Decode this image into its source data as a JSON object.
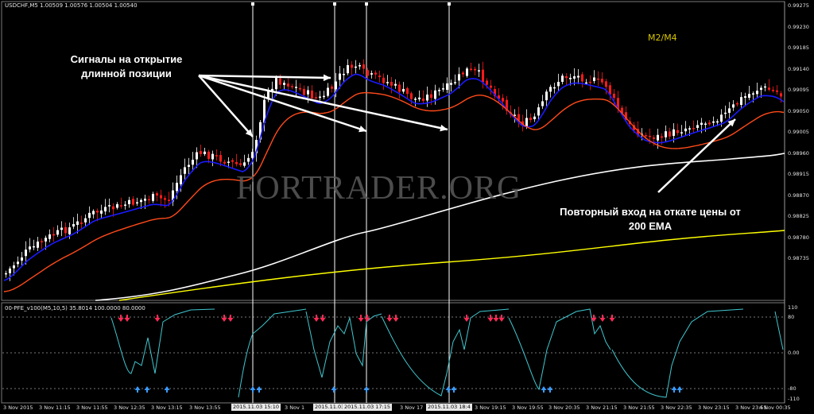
{
  "window": {
    "title": "USDCHF,M5  1.00509 1.00576 1.00504 1.00540",
    "timeframe_label": "M2/M4"
  },
  "indicator": {
    "label": "00-PFE_v100(M5,10,5) 35.8014 100.0000 80.0000",
    "y_ticks": [
      "110",
      "80",
      "0.00",
      "-80",
      "-110"
    ]
  },
  "annotations": {
    "entry_signals": "Сигналы на открытие длинной позиции",
    "reentry": "Повторный вход на откате цены от 200 EMA"
  },
  "watermark": "FORTRADER.ORG",
  "price_axis": {
    "ticks": [
      "0.99275",
      "0.99230",
      "0.99185",
      "0.99140",
      "0.99095",
      "0.99050",
      "0.99005",
      "0.98960",
      "0.98915",
      "0.98870",
      "0.98825",
      "0.98780",
      "0.98735"
    ]
  },
  "time_axis": {
    "ticks": [
      "3 Nov 2015",
      "3 Nov 11:15",
      "3 Nov 11:55",
      "3 Nov 12:35",
      "3 Nov 13:15",
      "3 Nov 13:55",
      "3 Nov 1",
      "3 Nov 17",
      "3 Nov 19:15",
      "3 Nov 19:55",
      "3 Nov 20:35",
      "3 Nov 21:15",
      "3 Nov 21:55",
      "3 Nov 22:35",
      "3 Nov 23:15",
      "3 Nov 23:55",
      "4 Nov 00:35"
    ],
    "highlighted": [
      "2015.11.03 15:10",
      "2015.11.03 16:5",
      "2015.11.03 17:15",
      "2015.11.03 18:4"
    ]
  },
  "colors": {
    "bull_candle": "#ffffff",
    "bear_candle": "#ff1a1a",
    "ema_fast": "#1a1aff",
    "ema_mid": "#ff4a1a",
    "ema_slow_white": "#ffffff",
    "ema_200_yellow": "#ffff00",
    "oscillator": "#40c8d0",
    "arrow_up": "#3a9bff",
    "arrow_down": "#ff2a55"
  }
}
